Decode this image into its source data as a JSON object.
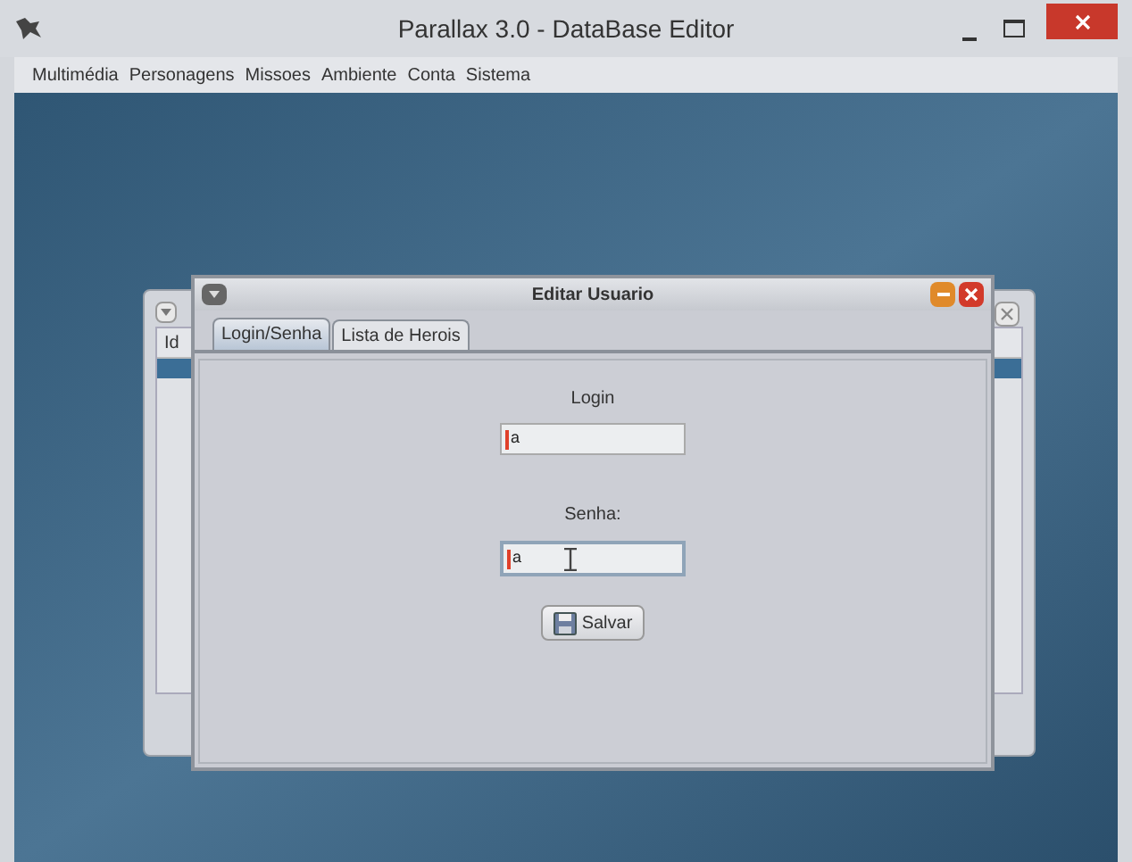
{
  "window": {
    "title": "Parallax 3.0 - DataBase Editor"
  },
  "menu": [
    "Multimédia",
    "Personagens",
    "Missoes",
    "Ambiente",
    "Conta",
    "Sistema"
  ],
  "background_window": {
    "table": {
      "columns": [
        "Id"
      ]
    }
  },
  "dialog": {
    "title": "Editar Usuario",
    "tabs": [
      {
        "label": "Login/Senha",
        "selected": true
      },
      {
        "label": "Lista de Herois",
        "selected": false
      }
    ],
    "fields": [
      {
        "label": "Login",
        "value": "a"
      },
      {
        "label": "Senha:",
        "value": "a"
      }
    ],
    "button": "Salvar"
  }
}
